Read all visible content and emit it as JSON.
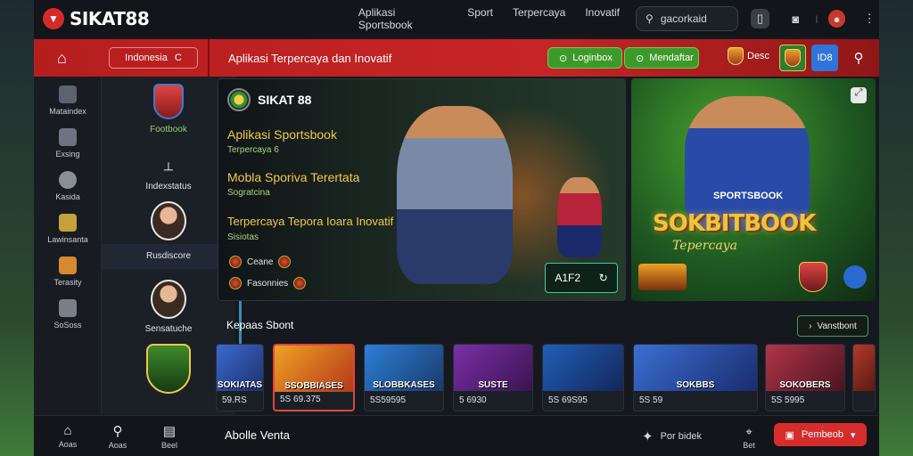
{
  "topbar": {
    "logo_text": "SIKAT88",
    "nav": [
      "Aplikasi Sportsbook",
      "Sport",
      "Terpercaya",
      "Inovatif"
    ],
    "search_value": "gacorkaid"
  },
  "redbar": {
    "language": "Indonesia",
    "tagline": "Aplikasi Terpercaya dan Inovatif",
    "btn_login": "Loginbox",
    "btn_register": "Mendaftar",
    "balance": "Desc",
    "flag_btn": "ID8"
  },
  "rail": [
    {
      "label": "Mataindex",
      "icon": "cube-icon",
      "color": "#5a6470"
    },
    {
      "label": "Exsing",
      "icon": "box-icon",
      "color": "#6b7480"
    },
    {
      "label": "Kasida",
      "icon": "globe-icon",
      "color": "#8a8f96"
    },
    {
      "label": "Lawinsanta",
      "icon": "card-icon",
      "color": "#c4a23a"
    },
    {
      "label": "Terasity",
      "icon": "trophy-icon",
      "color": "#d6892e"
    },
    {
      "label": "SoSoss",
      "icon": "dice-icon",
      "color": "#7b8088"
    }
  ],
  "panel2": {
    "sport_label": "Footbook",
    "index_label": "Indexstatus",
    "highlight_label": "Rusdiscore",
    "player_label": "Sensatuche"
  },
  "hero1": {
    "brand": "SIKAT 88",
    "title1": "Aplikasi Sportsbook",
    "sub1": "Terpercaya 6",
    "title2": "Mobla Sporiva Terertata",
    "sub2": "Sogratcina",
    "title3": "Terpercaya Tepora Ioara Inovatif",
    "sub3": "Sisiotas",
    "team1": "Ceane",
    "team2": "Fasonnies",
    "score": "A1F2"
  },
  "hero2": {
    "headline": "SOKBITBOOK",
    "subline": "Tepercaya",
    "small_label": "SPORTSBOOK"
  },
  "section": {
    "title": "Kepaas Sbont",
    "view_all": "Vanstbont"
  },
  "cards": [
    {
      "label": "SOKIATAS",
      "value": "59.RS",
      "color_a": "#3a6bd1",
      "color_b": "#1e2f6a"
    },
    {
      "label": "SSOBBIASES",
      "value": "5S 69.375",
      "color_a": "#f0a123",
      "color_b": "#b3381a"
    },
    {
      "label": "SLOBBKASES",
      "value": "5S59595",
      "color_a": "#2c7fd8",
      "color_b": "#1a3a6a"
    },
    {
      "label": "SUSTE",
      "value": "5 6930",
      "color_a": "#7a2fa8",
      "color_b": "#3a1450"
    },
    {
      "label": "",
      "value": "5S 69S95",
      "color_a": "#1f5fb8",
      "color_b": "#14265a"
    },
    {
      "label": "SOKBBS",
      "value": "5S 59",
      "color_a": "#3b6fd4",
      "color_b": "#1a2c6e"
    },
    {
      "label": "SOKOBERS",
      "value": "5S 5995",
      "color_a": "#b2344a",
      "color_b": "#4a1420"
    },
    {
      "label": "",
      "value": "",
      "color_a": "#b33a2a",
      "color_b": "#5a1a12"
    }
  ],
  "bottom": {
    "nav": [
      {
        "label": "Aoas",
        "icon": "home-icon"
      },
      {
        "label": "Aoas",
        "icon": "search-icon"
      },
      {
        "label": "Beel",
        "icon": "chat-icon"
      }
    ],
    "title": "Abolle Venta",
    "bookmark_label": "Por bidek",
    "cta_label": "Pembeob",
    "bet_label": "Bet"
  },
  "colors": {
    "brand_red": "#d42a2a",
    "accent_green": "#3d9a2a",
    "accent_gold": "#f2c33a"
  }
}
